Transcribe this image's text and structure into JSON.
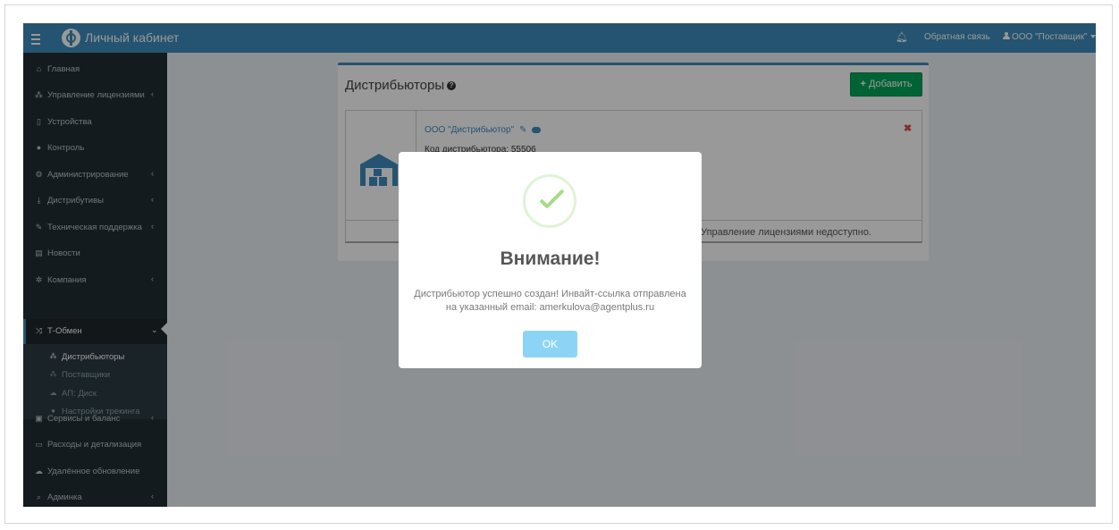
{
  "header": {
    "brand": "Личный кабинет",
    "feedback": "Обратная связь",
    "user": "ООО \"Поставщик\""
  },
  "sidebar": {
    "items": [
      {
        "label": "Главная",
        "icon": "home-icon",
        "chevron": ""
      },
      {
        "label": "Управление лицензиями",
        "icon": "sitemap-icon",
        "chevron": "‹"
      },
      {
        "label": "Устройства",
        "icon": "mobile-icon",
        "chevron": ""
      },
      {
        "label": "Контроль",
        "icon": "globe-icon",
        "chevron": ""
      },
      {
        "label": "Администрирование",
        "icon": "cogs-icon",
        "chevron": "‹"
      },
      {
        "label": "Дистрибутивы",
        "icon": "download-icon",
        "chevron": "‹"
      },
      {
        "label": "Техническая поддержка",
        "icon": "wrench-icon",
        "chevron": "‹"
      },
      {
        "label": "Новости",
        "icon": "newspaper-icon",
        "chevron": ""
      },
      {
        "label": "Компания",
        "icon": "gear-icon",
        "chevron": "‹"
      },
      {
        "label": "Т-Обмен",
        "icon": "shuffle-icon",
        "chevron": "⌄"
      }
    ],
    "submenu": [
      {
        "label": "Дистрибьюторы",
        "icon": "sitemap-icon"
      },
      {
        "label": "Поставщики",
        "icon": "sitemap-icon"
      },
      {
        "label": "АП: Диск",
        "icon": "cloud-icon"
      },
      {
        "label": "Настройки трекинга",
        "icon": "globe-icon"
      }
    ],
    "items2": [
      {
        "label": "Сервисы и баланс",
        "icon": "money-icon",
        "chevron": "‹"
      },
      {
        "label": "Расходы и детализация",
        "icon": "credit-card-icon",
        "chevron": ""
      },
      {
        "label": "Удалённое обновление",
        "icon": "cloud-upload-icon",
        "chevron": ""
      },
      {
        "label": "Админка",
        "icon": "search-icon",
        "chevron": "‹"
      }
    ]
  },
  "main": {
    "title": "Дистрибьюторы",
    "add_button": "Добавить",
    "card": {
      "name": "ООО \"Дистрибьютор\"",
      "line2": "Код дистрибьютора: 55506",
      "footer": "Управление лицензиями недоступно."
    }
  },
  "modal": {
    "title": "Внимание!",
    "text": "Дистрибьютор успешно создан! Инвайт-ссылка отправлена на указанный email: amerkulova@agentplus.ru",
    "ok": "OK"
  }
}
